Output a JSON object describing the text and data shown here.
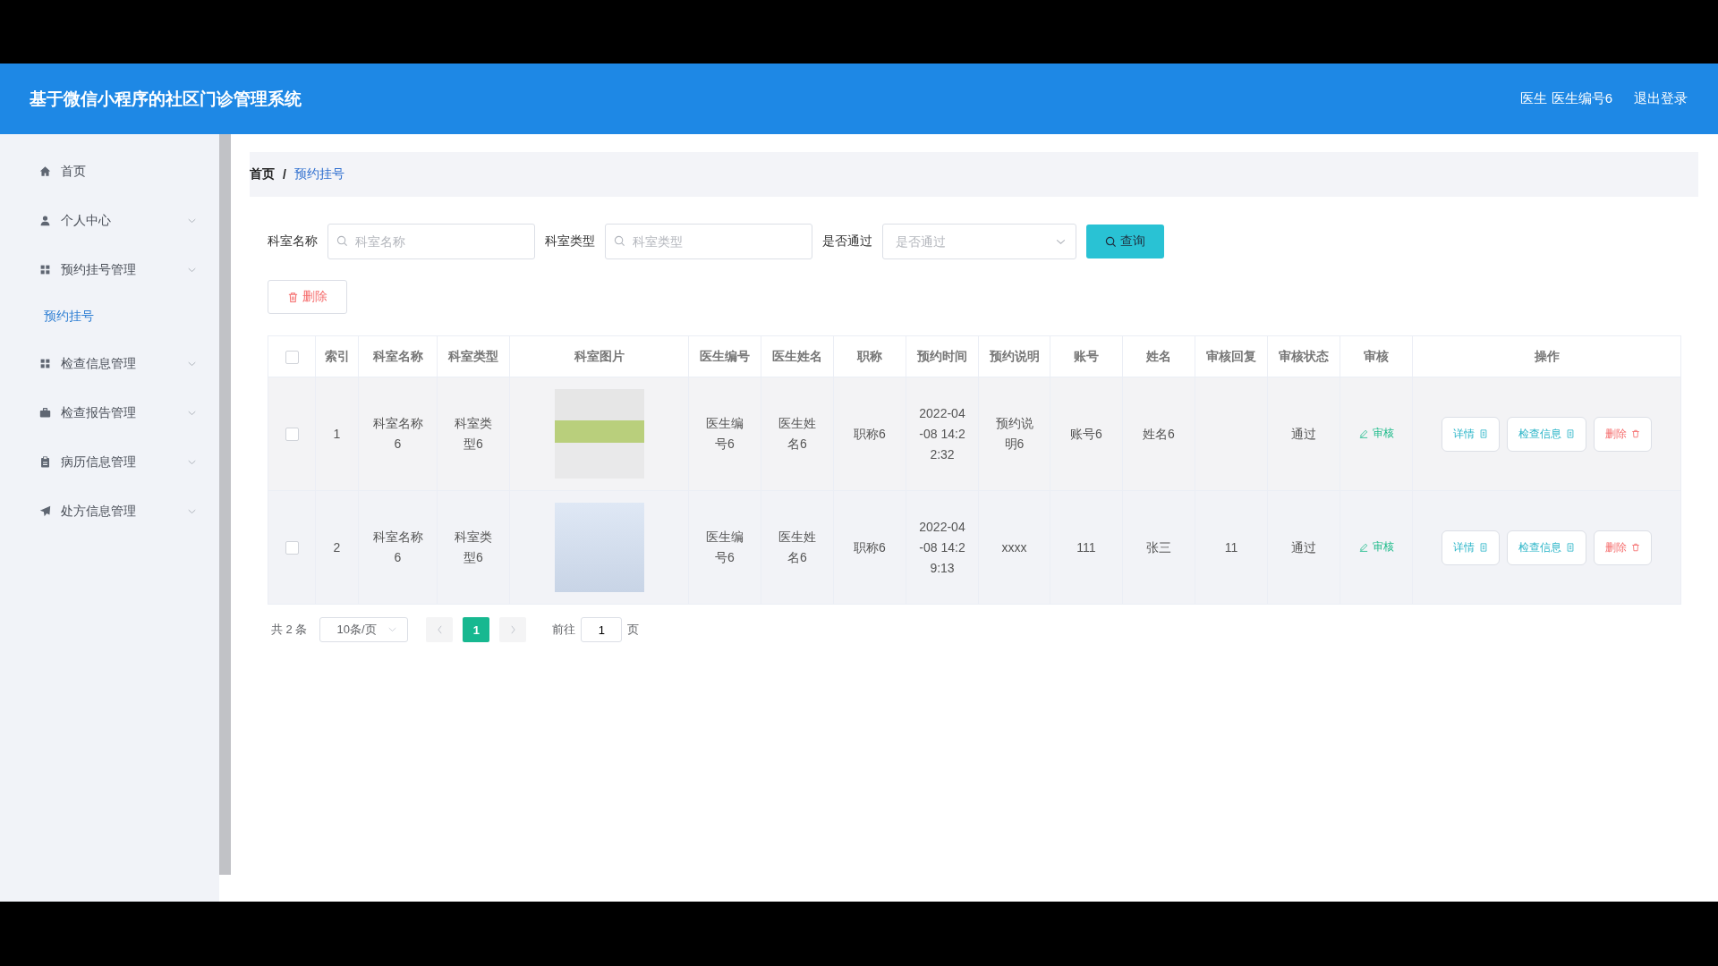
{
  "header": {
    "title": "基于微信小程序的社区门诊管理系统",
    "user": "医生 医生编号6",
    "logout": "退出登录"
  },
  "sidebar": {
    "items": [
      {
        "label": "首页",
        "kind": "link",
        "selected": false
      },
      {
        "label": "个人中心",
        "kind": "submenu",
        "selected": false
      },
      {
        "label": "预约挂号管理",
        "kind": "submenu",
        "selected": false,
        "children": [
          {
            "label": "预约挂号",
            "selected": true
          }
        ]
      },
      {
        "label": "检查信息管理",
        "kind": "submenu",
        "selected": false
      },
      {
        "label": "检查报告管理",
        "kind": "submenu",
        "selected": false
      },
      {
        "label": "病历信息管理",
        "kind": "submenu",
        "selected": false
      },
      {
        "label": "处方信息管理",
        "kind": "submenu",
        "selected": false
      }
    ]
  },
  "breadcrumb": {
    "items": [
      "首页",
      "预约挂号"
    ],
    "separator": "/"
  },
  "filters": [
    {
      "label": "科室名称",
      "kind": "text",
      "placeholder": "科室名称"
    },
    {
      "label": "科室类型",
      "kind": "text",
      "placeholder": "科室类型"
    },
    {
      "label": "是否通过",
      "kind": "select",
      "placeholder": "是否通过"
    }
  ],
  "search_button": "查询",
  "delete_button": "删除",
  "table": {
    "all_checked": false,
    "columns": [
      "索引",
      "科室名称",
      "科室类型",
      "科室图片",
      "医生编号",
      "医生姓名",
      "职称",
      "预约时间",
      "预约说明",
      "账号",
      "姓名",
      "审核回复",
      "审核状态",
      "审核",
      "操作"
    ],
    "rows": [
      {
        "checked": false,
        "index": "1",
        "dept_name": "科室名称6",
        "dept_type": "科室类型6",
        "doctor_no": "医生编号6",
        "doctor_name": "医生姓名6",
        "title": "职称6",
        "time": "2022-04-08 14:22:32",
        "note": "预约说明6",
        "account": "账号6",
        "name": "姓名6",
        "status": "通过",
        "review": "审核",
        "actions": [
          {
            "label": "详情",
            "kind": "info"
          },
          {
            "label": "检查信息",
            "kind": "info"
          },
          {
            "label": "删除",
            "kind": "danger"
          }
        ]
      },
      {
        "checked": false,
        "index": "2",
        "dept_name": "科室名称6",
        "dept_type": "科室类型6",
        "doctor_no": "医生编号6",
        "doctor_name": "医生姓名6",
        "title": "职称6",
        "time": "2022-04-08 14:29:13",
        "note": "xxxx",
        "account": "111",
        "name": "张三",
        "reply": "11",
        "status": "通过",
        "review": "审核",
        "actions": [
          {
            "label": "详情",
            "kind": "info"
          },
          {
            "label": "检查信息",
            "kind": "info"
          },
          {
            "label": "删除",
            "kind": "danger"
          }
        ]
      }
    ]
  },
  "pagination": {
    "total": "共 2 条",
    "page_size": "10条/页",
    "pages": [
      {
        "label": "1",
        "selected": true
      }
    ],
    "goto_label": "前往",
    "goto_value": "1",
    "goto_suffix": "页"
  }
}
